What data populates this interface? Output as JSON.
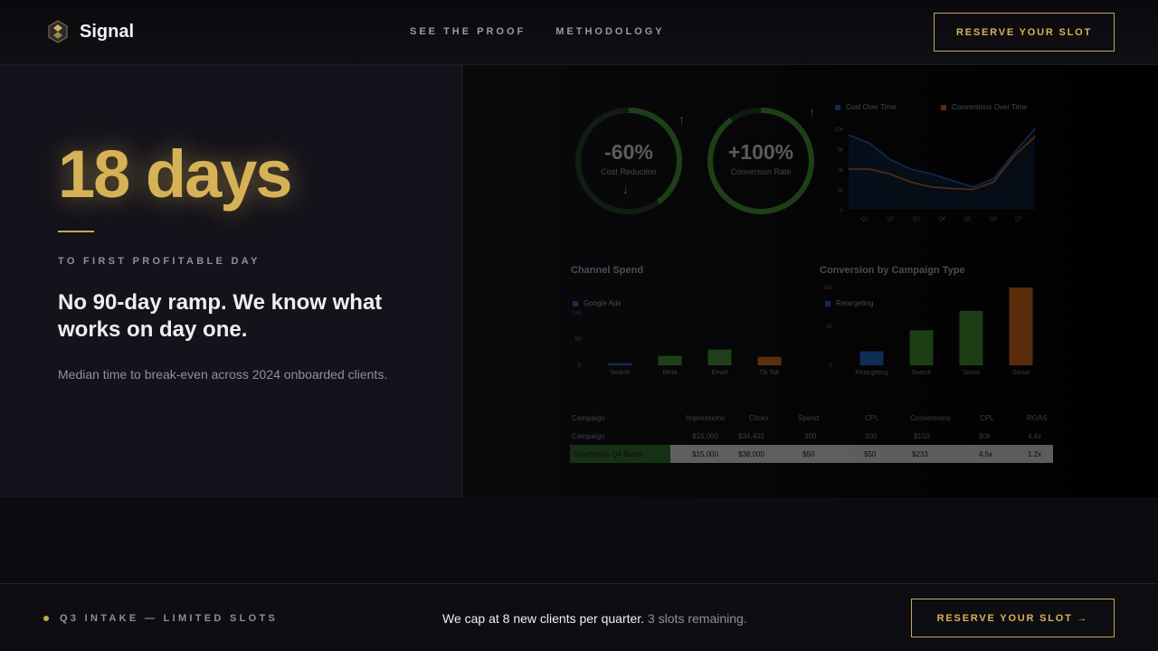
{
  "brand": {
    "name": "Signal"
  },
  "nav": {
    "items": [
      "SEE THE PROOF",
      "METHODOLOGY"
    ]
  },
  "header": {
    "cta_label": "RESERVE YOUR SLOT"
  },
  "hero": {
    "stat": "18 days",
    "stat_label": "TO FIRST PROFITABLE DAY",
    "headline": "No 90-day ramp. We know what works on day one.",
    "description": "Median time to break-even across 2024 onboarded clients.",
    "accent_color": "#d6b257"
  },
  "dashboard": {
    "gauges": [
      {
        "value": "-60%",
        "label": "Cost Reduction",
        "progress": 0.4
      },
      {
        "value": "+100%",
        "label": "Conversion Rate",
        "progress": 0.9
      }
    ],
    "line_chart": {
      "legend": [
        "Cost Over Time",
        "Conversions Over Time"
      ],
      "colors": [
        "#1e63c6",
        "#d5671a"
      ],
      "y_ticks": [
        "10k",
        "5k",
        "0k",
        "0k",
        "0"
      ],
      "x_ticks": [
        "Q1",
        "Q2",
        "Q3",
        "Q4",
        "Q5",
        "Q6",
        "Q7"
      ],
      "series": [
        {
          "name": "Cost Over Time",
          "values": [
            0.92,
            0.82,
            0.62,
            0.5,
            0.44,
            0.36,
            0.28,
            0.38,
            0.7,
            1.0
          ]
        },
        {
          "name": "Conversions Over Time",
          "values": [
            0.5,
            0.5,
            0.44,
            0.34,
            0.28,
            0.26,
            0.25,
            0.34,
            0.66,
            0.9
          ]
        }
      ]
    },
    "channel_spend": {
      "title": "Channel Spend",
      "legend": "Google Ads",
      "y_ticks": [
        "100",
        "50",
        "0"
      ],
      "categories": [
        "Search",
        "Meta",
        "Email",
        "Tik Tok"
      ],
      "values": [
        4,
        18,
        30,
        16
      ],
      "colors": [
        "#1e63c6",
        "#3f8f2d",
        "#3f8f2d",
        "#d5671a"
      ]
    },
    "conversion_by_type": {
      "title": "Conversion by Campaign Type",
      "legend": "Retargeting",
      "y_ticks": [
        "100",
        "50",
        "0"
      ],
      "categories": [
        "Retargeting",
        "Search",
        "Social",
        "Social"
      ],
      "values": [
        18,
        45,
        70,
        100
      ],
      "colors": [
        "#1e63c6",
        "#3f8f2d",
        "#3f8f2d",
        "#d5671a"
      ]
    },
    "table": {
      "headers": [
        "Campaign",
        "Impressions",
        "Clicks",
        "Spend",
        "CPL",
        "Conversions",
        "CPL",
        "ROAS"
      ],
      "rows": [
        [
          "Campaign",
          "$15,000",
          "$34,402",
          "300",
          "300",
          "$150",
          "$0k",
          "4.4x"
        ],
        [
          "Smartfinish Q4 Boost",
          "$15,000",
          "$38,000",
          "$50",
          "$50",
          "$233",
          "4.5x",
          "1.2x"
        ]
      ]
    }
  },
  "footer": {
    "intake": "Q3 INTAKE — LIMITED SLOTS",
    "cap_text": "We cap at 8 new clients per quarter.",
    "slots_text": "3 slots remaining.",
    "cta_label": "RESERVE YOUR SLOT →"
  }
}
